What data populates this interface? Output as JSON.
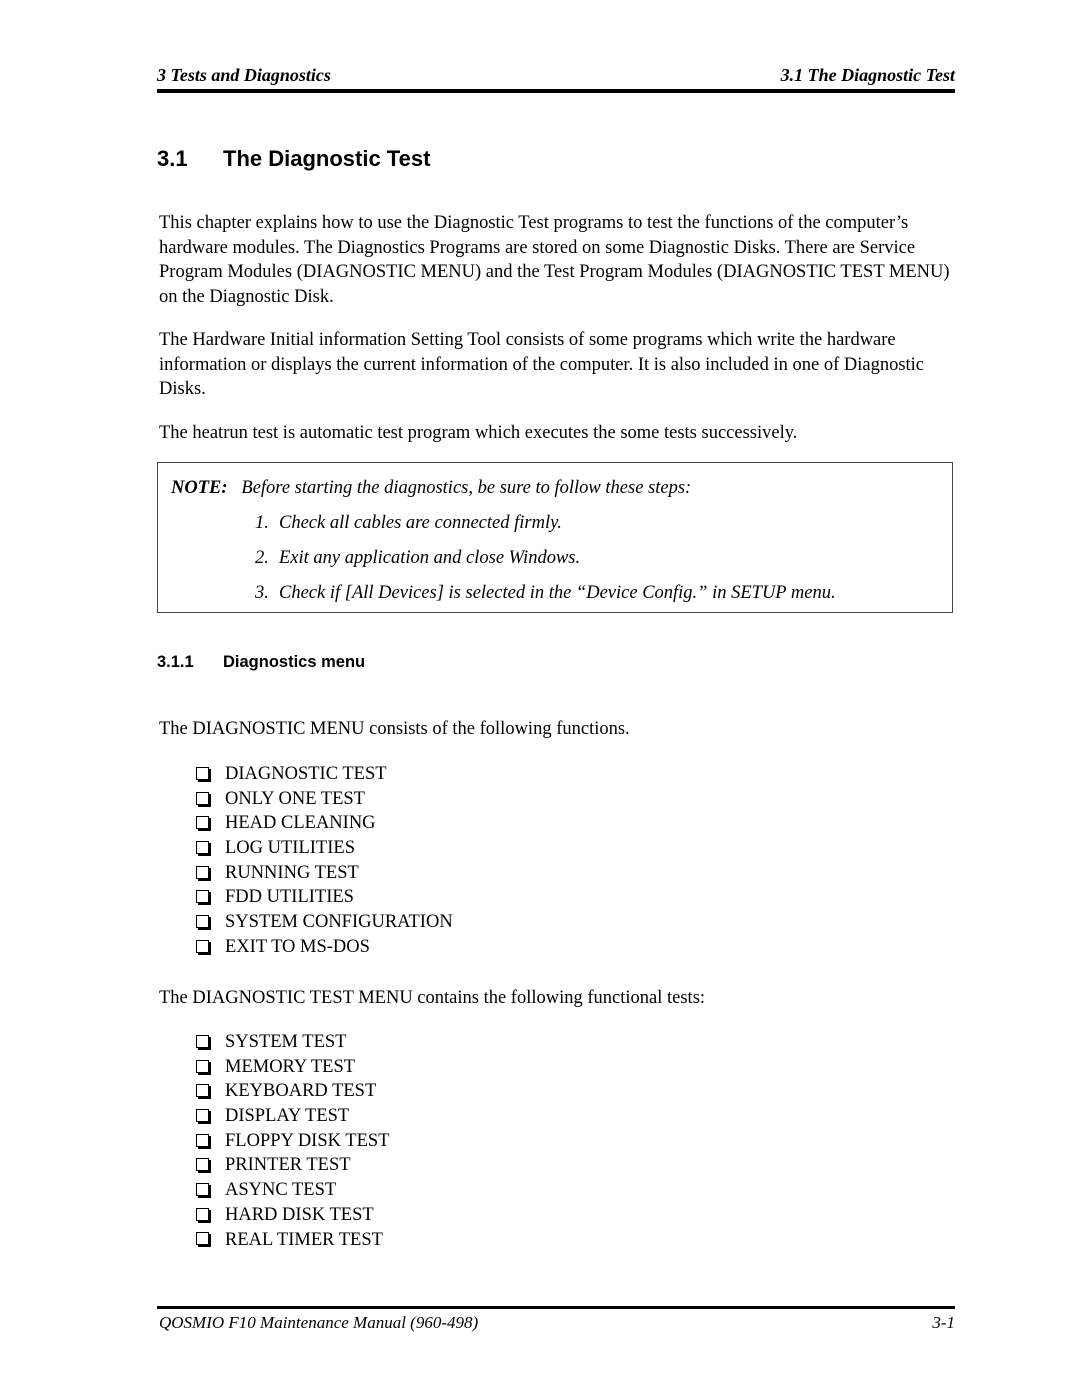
{
  "header": {
    "chapter": "3  Tests and Diagnostics",
    "section": "3.1  The Diagnostic Test"
  },
  "section": {
    "number": "3.1",
    "title": "The Diagnostic Test"
  },
  "paragraphs": [
    "This chapter explains how to use the Diagnostic Test programs to test the functions of the computer’s hardware modules. The Diagnostics Programs are stored on some Diagnostic Disks. There are Service Program Modules (DIAGNOSTIC MENU) and the Test Program Modules (DIAGNOSTIC TEST MENU) on the Diagnostic Disk.",
    "The Hardware Initial information Setting Tool consists of some programs which write the hardware information or displays the current information of the computer. It is also included in one of Diagnostic Disks.",
    "The heatrun test is automatic test program which executes the some tests successively."
  ],
  "note": {
    "label": "NOTE:",
    "intro": "Before starting the diagnostics, be sure to follow these steps:",
    "steps": [
      {
        "num": "1.",
        "text": "Check all cables are connected firmly."
      },
      {
        "num": "2.",
        "text": "Exit any application and close Windows."
      },
      {
        "num": "3.",
        "text": "Check if [All Devices] is selected in the “Device Config.” in SETUP menu."
      }
    ]
  },
  "subsection": {
    "number": "3.1.1",
    "title": "Diagnostics menu",
    "menu_intro": "The DIAGNOSTIC MENU consists of the following functions.",
    "menu_items": [
      "DIAGNOSTIC TEST",
      "ONLY ONE TEST",
      "HEAD CLEANING",
      "LOG UTILITIES",
      "RUNNING TEST",
      "FDD UTILITIES",
      "SYSTEM CONFIGURATION",
      "EXIT TO MS-DOS"
    ],
    "test_intro": "The DIAGNOSTIC TEST MENU contains the following functional tests:",
    "test_items": [
      "SYSTEM TEST",
      "MEMORY TEST",
      "KEYBOARD TEST",
      "DISPLAY TEST",
      "FLOPPY DISK TEST",
      "PRINTER TEST",
      "ASYNC TEST",
      "HARD DISK TEST",
      "REAL TIMER TEST"
    ]
  },
  "footer": {
    "manual": "QOSMIO F10 Maintenance Manual (960-498)",
    "page": "3-1"
  }
}
